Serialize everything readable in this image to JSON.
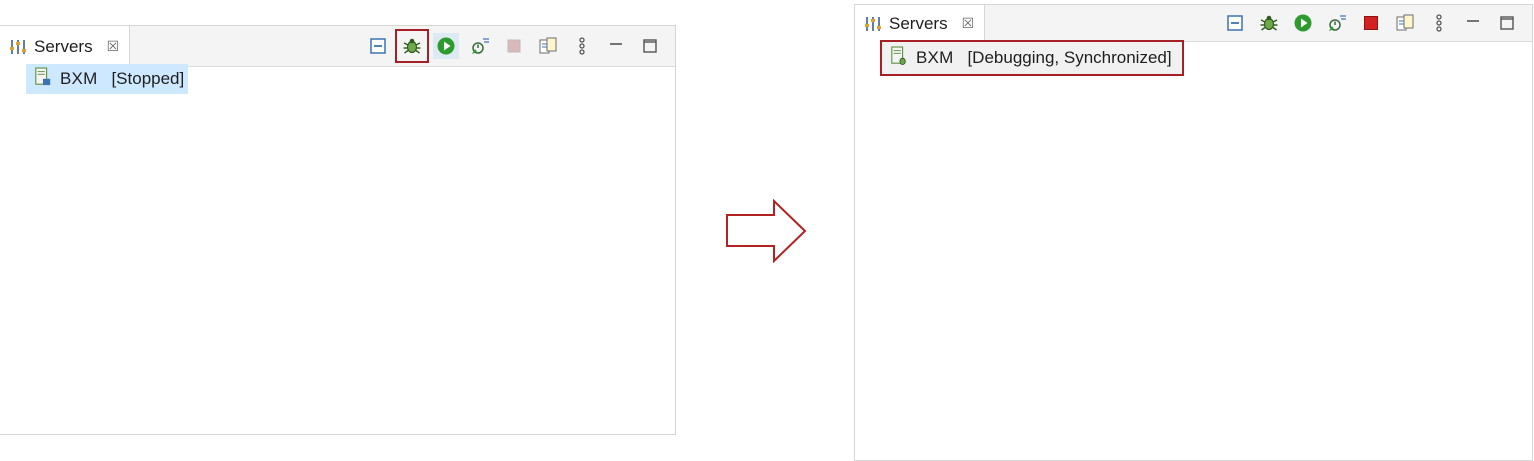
{
  "left_panel": {
    "tab": {
      "title": "Servers",
      "close_symbol": "☒"
    },
    "toolbar": [
      "collapse-all",
      "debug",
      "start",
      "profile",
      "stop",
      "publish",
      "view-menu",
      "minimize",
      "maximize"
    ],
    "server": {
      "name": "BXM",
      "status": "[Stopped]"
    }
  },
  "right_panel": {
    "tab": {
      "title": "Servers",
      "close_symbol": "☒"
    },
    "toolbar": [
      "collapse-all",
      "debug",
      "start",
      "profile",
      "stop",
      "publish",
      "view-menu",
      "minimize",
      "maximize"
    ],
    "server": {
      "name": "BXM",
      "status": "[Debugging, Synchronized]"
    }
  },
  "colors": {
    "highlight": "#a51f24",
    "selection": "#cde8ff",
    "start_green": "#2e9b2e",
    "stop_red": "#d32020"
  }
}
